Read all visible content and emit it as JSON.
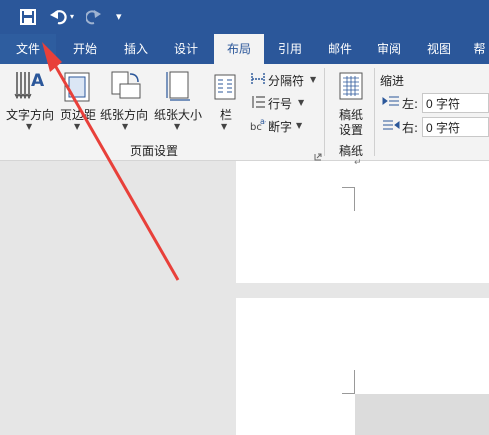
{
  "quick_access": {
    "save_icon": "save-icon",
    "undo_icon": "undo-icon",
    "redo_icon": "redo-icon",
    "customize_icon": "customize-icon"
  },
  "tabs": [
    {
      "label": "文件",
      "state": "file"
    },
    {
      "label": "开始",
      "state": ""
    },
    {
      "label": "插入",
      "state": ""
    },
    {
      "label": "设计",
      "state": ""
    },
    {
      "label": "布局",
      "state": "active"
    },
    {
      "label": "引用",
      "state": ""
    },
    {
      "label": "邮件",
      "state": ""
    },
    {
      "label": "审阅",
      "state": ""
    },
    {
      "label": "视图",
      "state": ""
    },
    {
      "label": "帮",
      "state": ""
    }
  ],
  "ribbon": {
    "text_direction": "文字方向",
    "margins": "页边距",
    "orientation": "纸张方向",
    "size": "纸张大小",
    "columns": "栏",
    "breaks": "分隔符",
    "line_numbers": "行号",
    "hyphenation": "断字",
    "page_setup_group": "页面设置",
    "draft_paper_line1": "稿纸",
    "draft_paper_line2": "设置",
    "draft_paper_group": "稿纸",
    "indent_title": "缩进",
    "indent_left_label": "左:",
    "indent_left_value": "0 字符",
    "indent_right_label": "右:",
    "indent_right_value": "0 字符"
  },
  "colors": {
    "title_bar": "#2b579a",
    "arrow": "#e8403a"
  }
}
